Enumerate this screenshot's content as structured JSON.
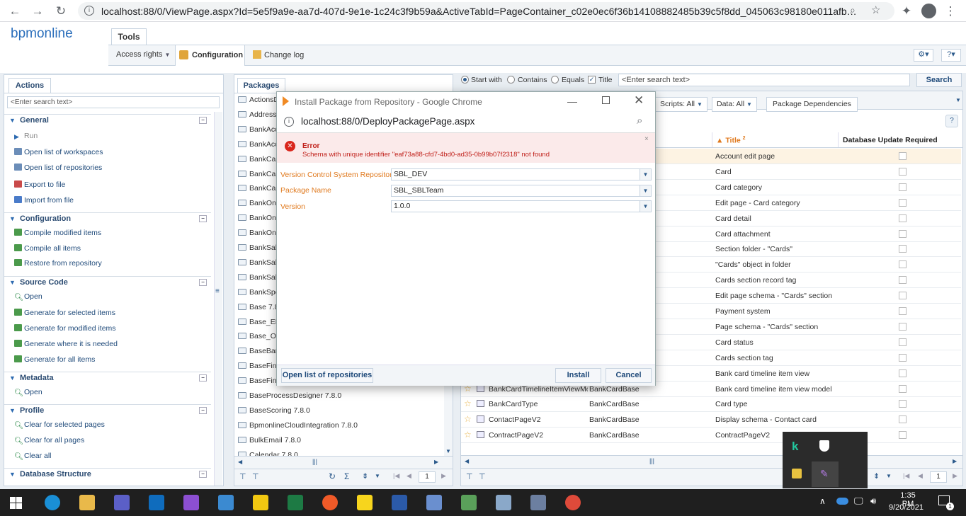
{
  "browser": {
    "url": "localhost:88/0/ViewPage.aspx?Id=5e5f9a9e-aa7d-407d-9e1e-1c24c3f9b59a&ActiveTabId=PageContainer_c02e0ec6f36b14108882485b39c5f8dd_045063c98180e011afb…"
  },
  "app": {
    "logo": "bpmonline",
    "top_tab": "Tools",
    "subtabs": [
      "Access rights",
      "Configuration",
      "Change log"
    ]
  },
  "actions": {
    "tab": "Actions",
    "search_placeholder": "<Enter search text>",
    "sections": [
      {
        "title": "General",
        "items": [
          "Run",
          "Open list of workspaces",
          "Open list of repositories",
          "Export to file",
          "Import from file"
        ]
      },
      {
        "title": "Configuration",
        "items": [
          "Compile modified items",
          "Compile all items",
          "Restore from repository"
        ]
      },
      {
        "title": "Source Code",
        "items": [
          "Open",
          "Generate for selected items",
          "Generate for modified items",
          "Generate where it is needed",
          "Generate for all items"
        ]
      },
      {
        "title": "Metadata",
        "items": [
          "Open"
        ]
      },
      {
        "title": "Profile",
        "items": [
          "Clear for selected pages",
          "Clear for all pages",
          "Clear all"
        ]
      },
      {
        "title": "Database Structure",
        "items": []
      }
    ]
  },
  "packages": {
    "tab": "Packages",
    "items": [
      "ActionsD",
      "AddressF",
      "BankAcc",
      "BankAcc",
      "BankCar",
      "BankCar",
      "BankCar",
      "BankOnb",
      "BankOnb",
      "BankOnb",
      "BankSale",
      "BankSale",
      "BankSale",
      "BankSpe",
      "Base 7.8",
      "Base_EN",
      "Base_Ob",
      "BaseBan",
      "BaseFina",
      "BaseFina",
      "BaseProcessDesigner 7.8.0",
      "BaseScoring 7.8.0",
      "BpmonlineCloudIntegration 7.8.0",
      "BulkEmail 7.8.0",
      "Calendar 7.8.0"
    ],
    "page": "1"
  },
  "search": {
    "options": [
      "Start with",
      "Contains",
      "Equals",
      "Title"
    ],
    "placeholder": "<Enter search text>",
    "button": "Search"
  },
  "filters": [
    "Scripts: All",
    "Data: All",
    "Package Dependencies"
  ],
  "grid": {
    "col_title": "Title",
    "col_title_sort": "2",
    "col_db": "Database Update Required",
    "rows": [
      {
        "name": "",
        "package": "",
        "title": "Account edit page"
      },
      {
        "name": "",
        "package": "",
        "title": "Card"
      },
      {
        "name": "",
        "package": "",
        "title": "Card category"
      },
      {
        "name": "",
        "package": "",
        "title": "Edit page - Card category"
      },
      {
        "name": "",
        "package": "",
        "title": "Card detail"
      },
      {
        "name": "",
        "package": "",
        "title": "Card attachment"
      },
      {
        "name": "",
        "package": "",
        "title": "Section folder - \"Cards\""
      },
      {
        "name": "",
        "package": "",
        "title": "\"Cards\" object in folder"
      },
      {
        "name": "",
        "package": "",
        "title": "Cards section record tag"
      },
      {
        "name": "",
        "package": "",
        "title": "Edit page schema -  \"Cards\" section"
      },
      {
        "name": "",
        "package": "",
        "title": "Payment system"
      },
      {
        "name": "",
        "package": "",
        "title": "Page schema - \"Cards\" section"
      },
      {
        "name": "",
        "package": "",
        "title": "Card status"
      },
      {
        "name": "",
        "package": "",
        "title": "Cards section tag"
      },
      {
        "name": "",
        "package": "",
        "title": "Bank card timeline item view"
      },
      {
        "name": "BankCardTimelineItemViewMoc",
        "package": "BankCardBase",
        "title": "Bank card timeline item view model"
      },
      {
        "name": "BankCardType",
        "package": "BankCardBase",
        "title": "Card type"
      },
      {
        "name": "ContactPageV2",
        "package": "BankCardBase",
        "title": "Display schema - Contact card"
      },
      {
        "name": "ContractPageV2",
        "package": "BankCardBase",
        "title": "ContractPageV2"
      }
    ],
    "page": "1"
  },
  "dialog": {
    "title": "Install Package from Repository - Google Chrome",
    "url": "localhost:88/0/DeployPackagePage.aspx",
    "error_title": "Error",
    "error_message": "Schema with unique identifier \"eaf73a88-cfd7-4bd0-ad35-0b99b07f2318\" not found",
    "fields": [
      {
        "label": "Version Control System Repository",
        "value": "SBL_DEV"
      },
      {
        "label": "Package Name",
        "value": "SBL_SBLTeam"
      },
      {
        "label": "Version",
        "value": "1.0.0"
      }
    ],
    "btn_open_list": "Open list of repositories",
    "btn_install": "Install",
    "btn_cancel": "Cancel"
  },
  "taskbar": {
    "time": "1:35 PM",
    "date": "9/20/2021",
    "notif_count": "1"
  },
  "colors": {
    "accent": "#2d4d73",
    "link": "#1f4a7a",
    "label": "#e07a1f",
    "error": "#d9261c"
  }
}
